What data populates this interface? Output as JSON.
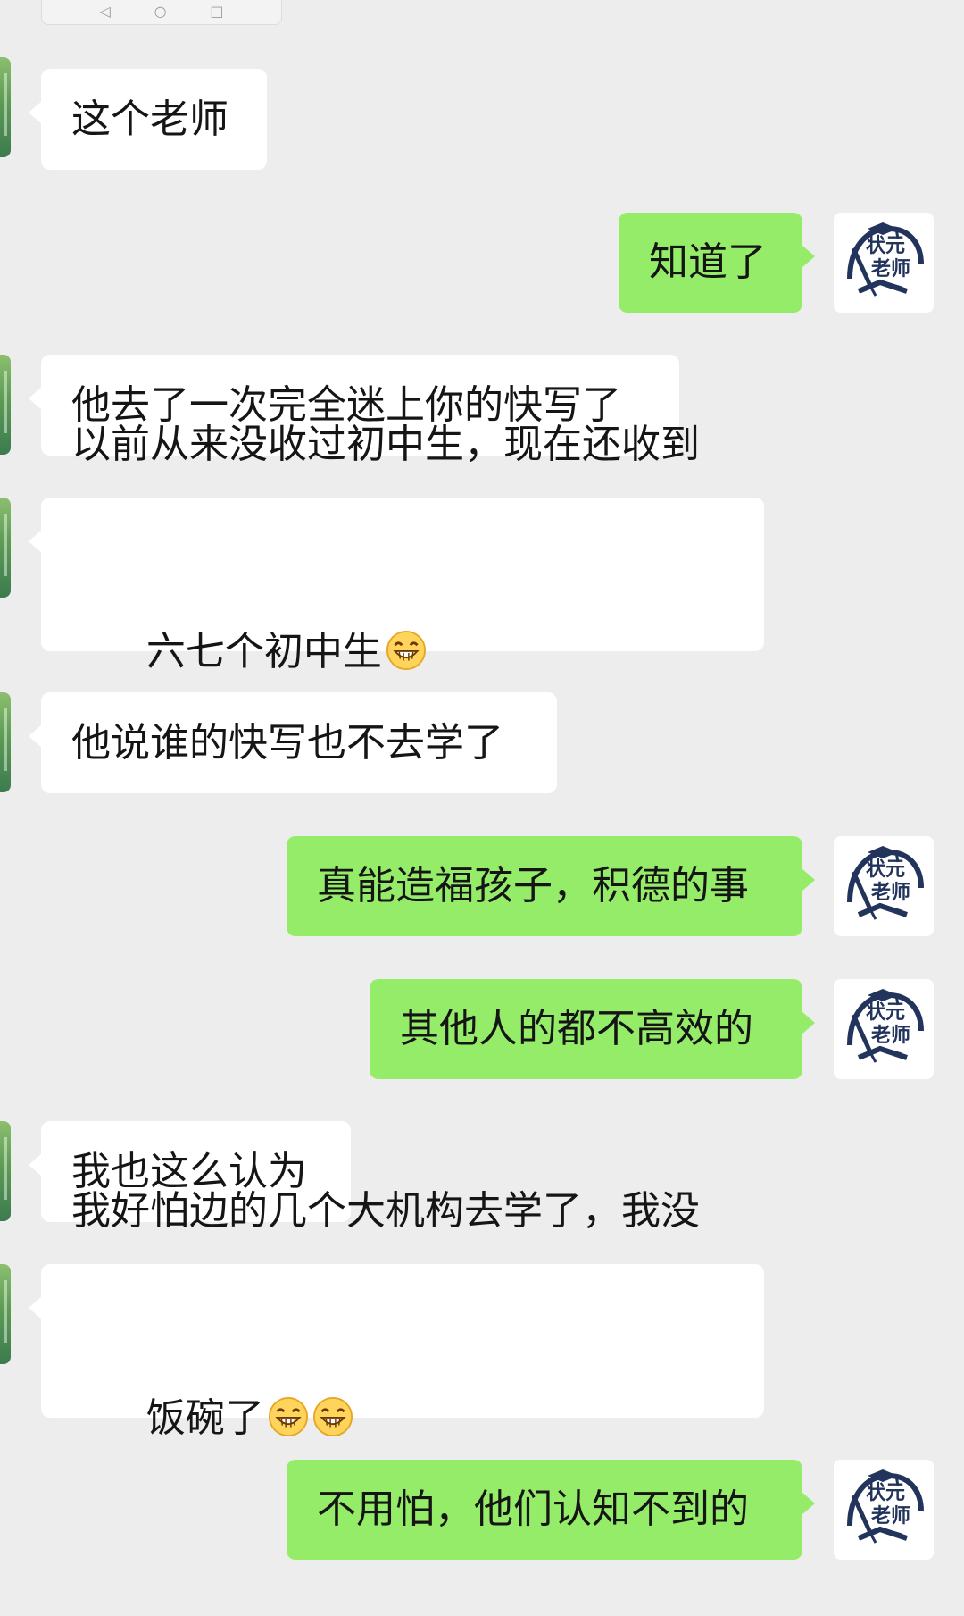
{
  "messages": [
    {
      "side": "left",
      "text": "这个老师"
    },
    {
      "side": "right",
      "text": "知道了"
    },
    {
      "side": "left",
      "text": "他去了一次完全迷上你的快写了"
    },
    {
      "side": "left",
      "lines": [
        "以前从来没收过初中生，现在还收到",
        "六七个初中生"
      ],
      "emoji_count": 1
    },
    {
      "side": "left",
      "text": "他说谁的快写也不去学了"
    },
    {
      "side": "right",
      "text": "真能造福孩子，积德的事"
    },
    {
      "side": "right",
      "text": "其他人的都不高效的"
    },
    {
      "side": "left",
      "text": "我也这么认为"
    },
    {
      "side": "left",
      "lines": [
        "我好怕边的几个大机构去学了，我没",
        "饭碗了"
      ],
      "emoji_count": 2
    },
    {
      "side": "right",
      "text": "不用怕，他们认知不到的"
    }
  ],
  "avatar_right": {
    "text_top": "状元",
    "text_bottom": "老师"
  },
  "emoji_name": "grinning-face",
  "colors": {
    "background": "#ededed",
    "left_bubble": "#ffffff",
    "right_bubble": "#95ec69",
    "avatar_blue": "#22345c"
  }
}
